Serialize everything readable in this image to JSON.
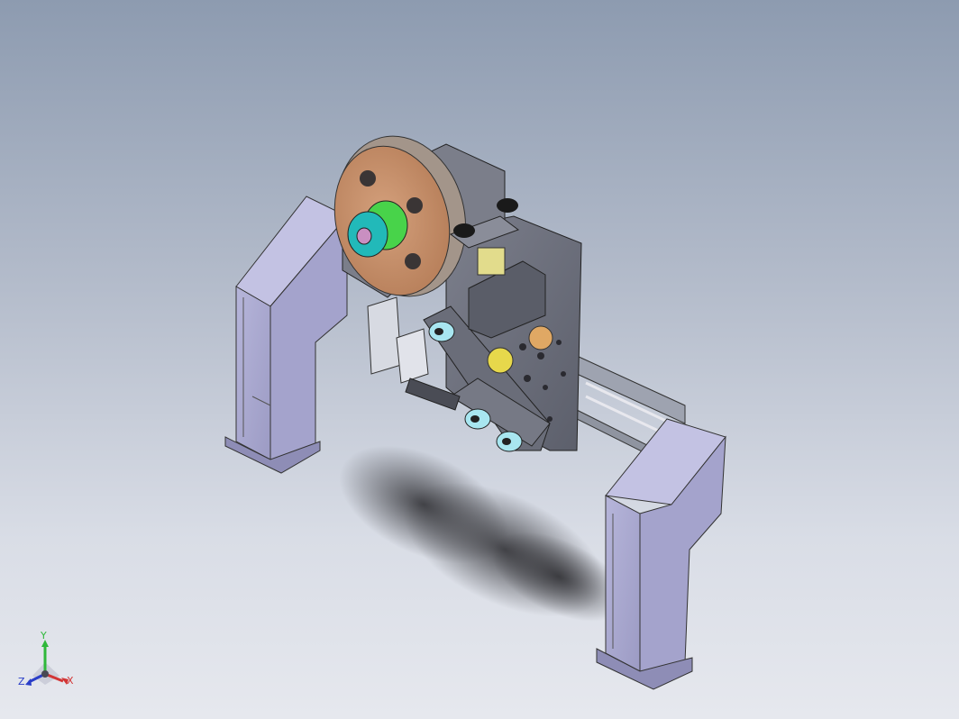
{
  "viewport": {
    "background_top": "#8d9bb0",
    "background_bottom": "#e6e8ee"
  },
  "model": {
    "frame_color": "#a7a7cf",
    "plate_color": "#6c6f7c",
    "pulley_color": "#c9926d",
    "hub_colors": [
      "#22b9b9",
      "#48d34a",
      "#c98fc1"
    ],
    "roller_colors": [
      "#a8e6f0",
      "#e7d84b",
      "#f2f2a0"
    ]
  },
  "triad": {
    "y_label": "Y",
    "x_label": "X",
    "z_label": "Z",
    "y_color": "#2fb83a",
    "x_color": "#d23535",
    "z_color": "#2a3ec8"
  }
}
